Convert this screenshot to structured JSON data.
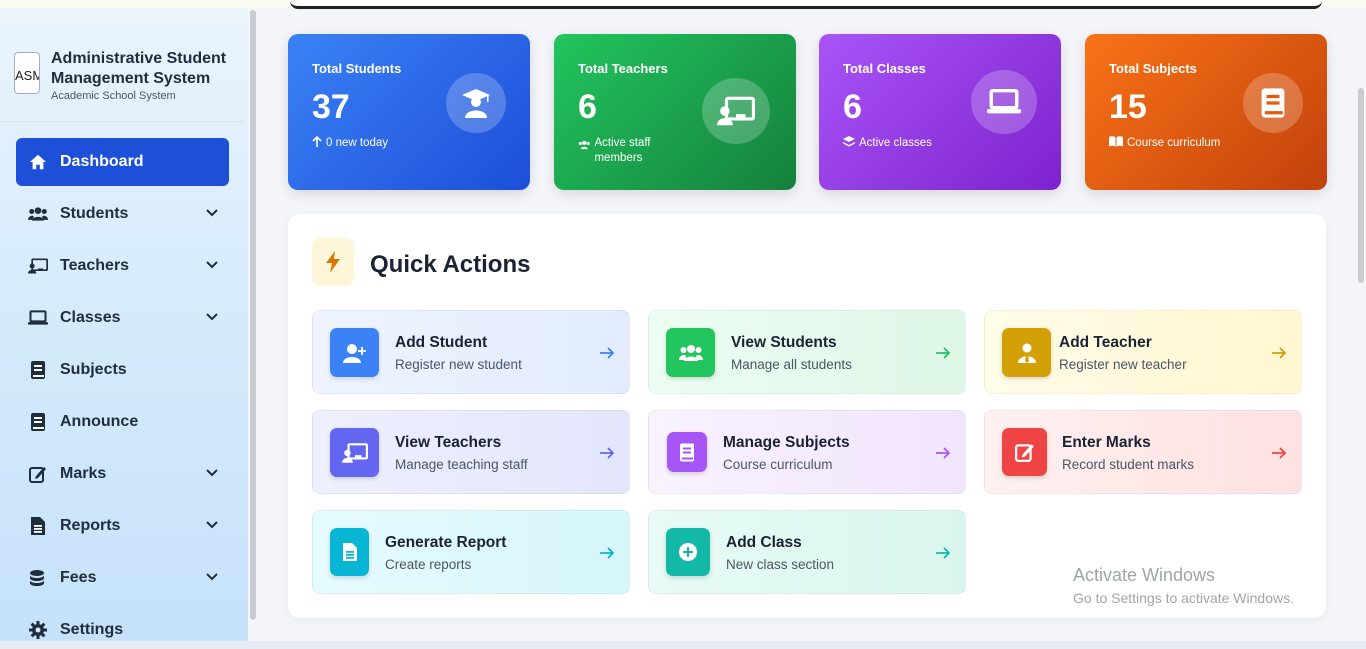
{
  "brand": {
    "logo_alt": "ASMS",
    "title": "Administrative Student Management System",
    "subtitle": "Academic School System"
  },
  "sidebar": {
    "items": [
      {
        "label": "Dashboard",
        "icon": "home-icon",
        "active": true,
        "expandable": false
      },
      {
        "label": "Students",
        "icon": "users-icon",
        "active": false,
        "expandable": true
      },
      {
        "label": "Teachers",
        "icon": "chalkboard-teacher-icon",
        "active": false,
        "expandable": true
      },
      {
        "label": "Classes",
        "icon": "laptop-icon",
        "active": false,
        "expandable": true
      },
      {
        "label": "Subjects",
        "icon": "book-icon",
        "active": false,
        "expandable": false
      },
      {
        "label": "Announce",
        "icon": "book-icon",
        "active": false,
        "expandable": false
      },
      {
        "label": "Marks",
        "icon": "edit-icon",
        "active": false,
        "expandable": true
      },
      {
        "label": "Reports",
        "icon": "file-icon",
        "active": false,
        "expandable": true
      },
      {
        "label": "Fees",
        "icon": "coins-icon",
        "active": false,
        "expandable": true
      },
      {
        "label": "Settings",
        "icon": "gear-icon",
        "active": false,
        "expandable": false
      }
    ]
  },
  "stats": [
    {
      "label": "Total Students",
      "value": "37",
      "sub": "0 new today",
      "sub_icon": "arrow-up-icon",
      "icon": "graduate-icon",
      "color_from": "#3b82f6",
      "color_to": "#1d4ed8"
    },
    {
      "label": "Total Teachers",
      "value": "6",
      "sub": "Active staff members",
      "sub_icon": "users-icon",
      "icon": "chalkboard-teacher-icon",
      "color_from": "#22c55e",
      "color_to": "#15803d"
    },
    {
      "label": "Total Classes",
      "value": "6",
      "sub": "Active classes",
      "sub_icon": "layers-icon",
      "icon": "laptop-icon",
      "color_from": "#a855f7",
      "color_to": "#7e22ce"
    },
    {
      "label": "Total Subjects",
      "value": "15",
      "sub": "Course curriculum",
      "sub_icon": "book-open-icon",
      "icon": "book-icon",
      "color_from": "#f97316",
      "color_to": "#c2410c"
    }
  ],
  "quick_actions": {
    "title": "Quick Actions",
    "items": [
      {
        "title": "Add Student",
        "sub": "Register new student",
        "icon": "user-plus-icon",
        "icon_bg": "#3b82f6",
        "bg": "#e6efff",
        "arrow": "#3b82f6"
      },
      {
        "title": "View Students",
        "sub": "Manage all students",
        "icon": "users-icon",
        "icon_bg": "#22c55e",
        "bg": "#e5faec",
        "arrow": "#22c55e"
      },
      {
        "title": "Add Teacher",
        "sub": "Register new teacher",
        "icon": "user-tie-icon",
        "icon_bg": "#d4a008",
        "bg": "#fffbe1",
        "arrow": "#d4a008"
      },
      {
        "title": "View Teachers",
        "sub": "Manage teaching staff",
        "icon": "chalkboard-teacher-icon",
        "icon_bg": "#6366f1",
        "bg": "#e9ebfd",
        "arrow": "#6366f1"
      },
      {
        "title": "Manage Subjects",
        "sub": "Course curriculum",
        "icon": "book-icon",
        "icon_bg": "#a855f7",
        "bg": "#f5ebfe",
        "arrow": "#a855f7"
      },
      {
        "title": "Enter Marks",
        "sub": "Record student marks",
        "icon": "edit-icon",
        "icon_bg": "#ef4444",
        "bg": "#ffe5e5",
        "arrow": "#ef4444"
      },
      {
        "title": "Generate Report",
        "sub": "Create reports",
        "icon": "file-icon",
        "icon_bg": "#06b6d4",
        "bg": "#dcf8fc",
        "arrow": "#06b6d4"
      },
      {
        "title": "Add Class",
        "sub": "New class section",
        "icon": "plus-circle-icon",
        "icon_bg": "#14b8a6",
        "bg": "#def8f1",
        "arrow": "#14b8a6"
      }
    ]
  },
  "watermark": {
    "line1": "Activate Windows",
    "line2": "Go to Settings to activate Windows."
  }
}
